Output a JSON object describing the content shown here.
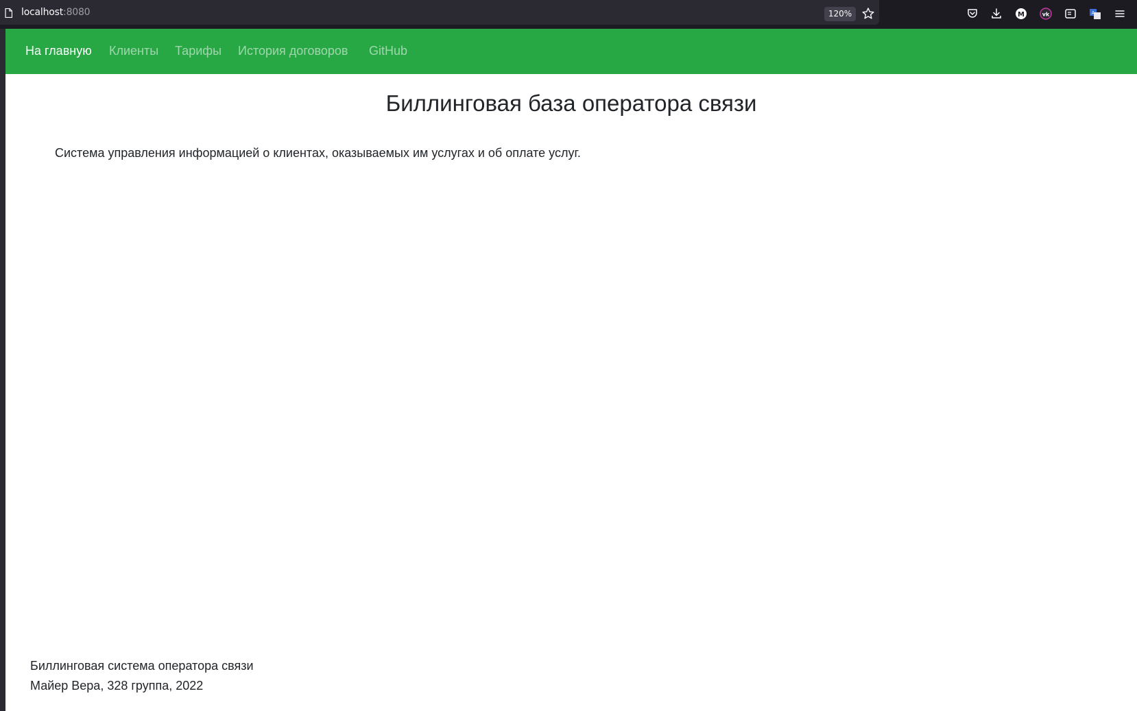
{
  "browser": {
    "url_host": "localhost",
    "url_port": ":8080",
    "zoom": "120%",
    "toolbar_icons": [
      "pocket-icon",
      "download-icon",
      "account-m-icon",
      "vk-icon",
      "reader-icon",
      "translate-icon",
      "menu-icon"
    ]
  },
  "navbar": {
    "items": [
      {
        "label": "На главную",
        "active": true
      },
      {
        "label": "Клиенты",
        "active": false
      },
      {
        "label": "Тарифы",
        "active": false
      },
      {
        "label": "История договоров",
        "active": false
      },
      {
        "label": "GitHub",
        "active": false
      }
    ],
    "color": "#28a745"
  },
  "main": {
    "title": "Биллинговая база оператора связи",
    "lead": "Система управления информацией о клиентах, оказываемых им услугах и об оплате услуг."
  },
  "footer": {
    "line1": "Биллинговая система оператора связи",
    "line2": "Майер Вера, 328 группа, 2022"
  }
}
